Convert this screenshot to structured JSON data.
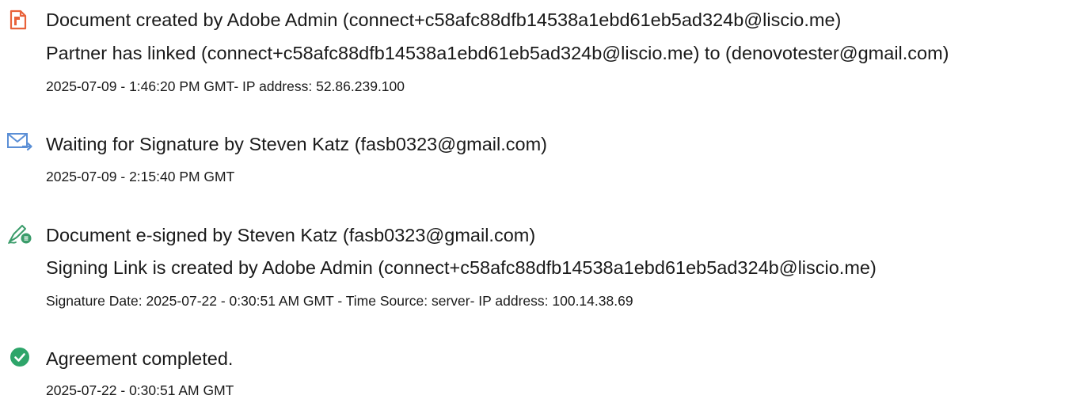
{
  "events": [
    {
      "icon": "document-created-icon",
      "lines": [
        "Document created by Adobe Admin (connect+c58afc88dfb14538a1ebd61eb5ad324b@liscio.me)",
        "Partner has linked (connect+c58afc88dfb14538a1ebd61eb5ad324b@liscio.me) to (denovotester@gmail.com)"
      ],
      "meta": "2025-07-09 - 1:46:20 PM GMT- IP address: 52.86.239.100"
    },
    {
      "icon": "email-sent-icon",
      "lines": [
        "Waiting for Signature by Steven Katz (fasb0323@gmail.com)"
      ],
      "meta": "2025-07-09 - 2:15:40 PM GMT"
    },
    {
      "icon": "esign-pen-icon",
      "lines": [
        "Document e-signed by Steven Katz (fasb0323@gmail.com)",
        "Signing Link is created by Adobe Admin (connect+c58afc88dfb14538a1ebd61eb5ad324b@liscio.me)"
      ],
      "meta": "Signature Date: 2025-07-22 - 0:30:51 AM GMT - Time Source: server- IP address: 100.14.38.69"
    },
    {
      "icon": "checkmark-circle-icon",
      "lines": [
        "Agreement completed."
      ],
      "meta": "2025-07-22 - 0:30:51 AM GMT"
    }
  ],
  "colors": {
    "document_icon": "#e8623a",
    "email_icon": "#5b8fd6",
    "pen_icon": "#3a9c6a",
    "check_icon": "#2ea56a"
  }
}
